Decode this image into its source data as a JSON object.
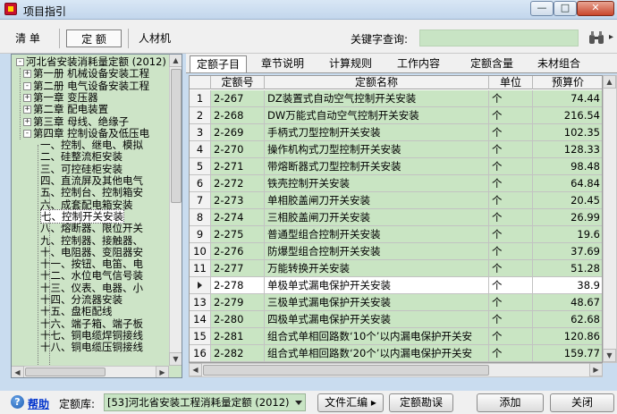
{
  "window": {
    "title": "项目指引"
  },
  "toolbar": {
    "tabs": [
      "清 单",
      "定 额",
      "人材机"
    ],
    "keyword_label": "关键字查询:",
    "keyword_value": ""
  },
  "tree": {
    "items": [
      {
        "label": "河北省安装消耗量定额 (2012)",
        "level": 0,
        "expander": "-"
      },
      {
        "label": "第一册 机械设备安装工程",
        "level": 1,
        "expander": "+"
      },
      {
        "label": "第二册 电气设备安装工程",
        "level": 1,
        "expander": "-"
      },
      {
        "label": "第一章 变压器",
        "level": 2,
        "expander": "+"
      },
      {
        "label": "第二章 配电装置",
        "level": 2,
        "expander": "+"
      },
      {
        "label": "第三章 母线、绝缘子",
        "level": 2,
        "expander": "+"
      },
      {
        "label": "第四章 控制设备及低压电",
        "level": 2,
        "expander": "-"
      },
      {
        "label": "一、控制、继电、模拟",
        "level": 3,
        "expander": ""
      },
      {
        "label": "二、硅整流柜安装",
        "level": 3,
        "expander": ""
      },
      {
        "label": "三、可控硅柜安装",
        "level": 3,
        "expander": ""
      },
      {
        "label": "四、直流屏及其他电气",
        "level": 3,
        "expander": ""
      },
      {
        "label": "五、控制台、控制箱安",
        "level": 3,
        "expander": ""
      },
      {
        "label": "六、成套配电箱安装",
        "level": 3,
        "expander": ""
      },
      {
        "label": "七、控制开关安装",
        "level": 3,
        "expander": ""
      },
      {
        "label": "八、熔断器、限位开关",
        "level": 3,
        "expander": ""
      },
      {
        "label": "九、控制器、接触器、",
        "level": 3,
        "expander": ""
      },
      {
        "label": "十、电阻器、变阻器安",
        "level": 3,
        "expander": ""
      },
      {
        "label": "十一、按钮、电笛、电",
        "level": 3,
        "expander": ""
      },
      {
        "label": "十二、水位电气信号装",
        "level": 3,
        "expander": ""
      },
      {
        "label": "十三、仪表、电器、小",
        "level": 3,
        "expander": ""
      },
      {
        "label": "十四、分流器安装",
        "level": 3,
        "expander": ""
      },
      {
        "label": "十五、盘柜配线",
        "level": 3,
        "expander": ""
      },
      {
        "label": "十六、端子箱、端子板",
        "level": 3,
        "expander": ""
      },
      {
        "label": "十七、铜电缆焊铜接线",
        "level": 3,
        "expander": ""
      },
      {
        "label": "十八、铜电缆压铜接线",
        "level": 3,
        "expander": ""
      }
    ]
  },
  "right_tabs": [
    "定额子目",
    "章节说明",
    "计算规则",
    "工作内容",
    "定额含量",
    "未材组合"
  ],
  "grid": {
    "columns": [
      "定额号",
      "定额名称",
      "单位",
      "预算价"
    ],
    "rows": [
      {
        "n": "1",
        "code": "2-267",
        "name": "DZ装置式自动空气控制开关安装",
        "unit": "个",
        "price": "74.44"
      },
      {
        "n": "2",
        "code": "2-268",
        "name": "DW万能式自动空气控制开关安装",
        "unit": "个",
        "price": "216.54"
      },
      {
        "n": "3",
        "code": "2-269",
        "name": "手柄式刀型控制开关安装",
        "unit": "个",
        "price": "102.35"
      },
      {
        "n": "4",
        "code": "2-270",
        "name": "操作机构式刀型控制开关安装",
        "unit": "个",
        "price": "128.33"
      },
      {
        "n": "5",
        "code": "2-271",
        "name": "带熔断器式刀型控制开关安装",
        "unit": "个",
        "price": "98.48"
      },
      {
        "n": "6",
        "code": "2-272",
        "name": "铁壳控制开关安装",
        "unit": "个",
        "price": "64.84"
      },
      {
        "n": "7",
        "code": "2-273",
        "name": "单相胶盖闸刀开关安装",
        "unit": "个",
        "price": "20.45"
      },
      {
        "n": "8",
        "code": "2-274",
        "name": "三相胶盖闸刀开关安装",
        "unit": "个",
        "price": "26.99"
      },
      {
        "n": "9",
        "code": "2-275",
        "name": "普通型组合控制开关安装",
        "unit": "个",
        "price": "19.6"
      },
      {
        "n": "10",
        "code": "2-276",
        "name": "防爆型组合控制开关安装",
        "unit": "个",
        "price": "37.69"
      },
      {
        "n": "11",
        "code": "2-277",
        "name": "万能转换开关安装",
        "unit": "个",
        "price": "51.28"
      },
      {
        "n": "",
        "code": "2-278",
        "name": "单极单式漏电保护开关安装",
        "unit": "个",
        "price": "38.9"
      },
      {
        "n": "13",
        "code": "2-279",
        "name": "三极单式漏电保护开关安装",
        "unit": "个",
        "price": "48.67"
      },
      {
        "n": "14",
        "code": "2-280",
        "name": "四极单式漏电保护开关安装",
        "unit": "个",
        "price": "62.68"
      },
      {
        "n": "15",
        "code": "2-281",
        "name": "组合式单相回路数‘10个’以内漏电保护开关安",
        "unit": "个",
        "price": "120.86"
      },
      {
        "n": "16",
        "code": "2-282",
        "name": "组合式单相回路数‘20个’以内漏电保护开关安",
        "unit": "个",
        "price": "159.77"
      }
    ]
  },
  "bottom": {
    "help_label": "帮助",
    "lib_label": "定额库:",
    "lib_value": "[53]河北省安装工程消耗量定额 (2012)",
    "btn_summary": "文件汇编 ▸",
    "btn_errata": "定额勘误",
    "btn_add": "添加",
    "btn_close": "关闭"
  }
}
